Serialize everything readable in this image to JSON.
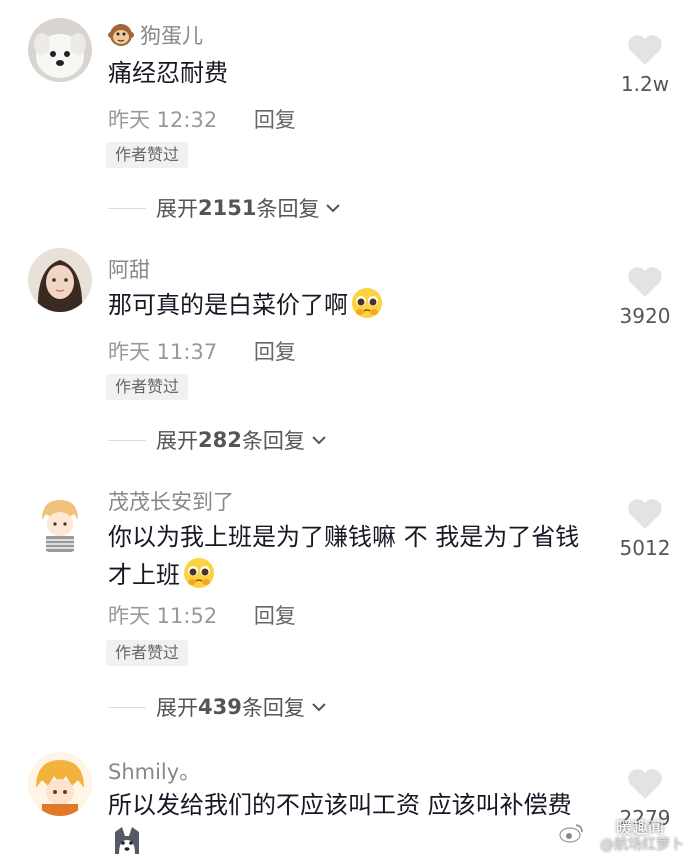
{
  "comments": [
    {
      "username": "狗蛋儿",
      "text": "痛经忍耐费",
      "time": "昨天 12:32",
      "reply_label": "回复",
      "author_liked": "作者赞过",
      "expand_prefix": "展开",
      "expand_count": "2151",
      "expand_suffix": "条回复",
      "likes": "1.2w",
      "badge_icon": "monkey-emoji"
    },
    {
      "username": "阿甜",
      "text": "那可真的是白菜价了啊",
      "time": "昨天 11:37",
      "reply_label": "回复",
      "author_liked": "作者赞过",
      "expand_prefix": "展开",
      "expand_count": "282",
      "expand_suffix": "条回复",
      "likes": "3920",
      "emoji_icon": "pleading-face-emoji"
    },
    {
      "username": "茂茂长安到了",
      "text": "你以为我上班是为了赚钱嘛 不 我是为了省钱才上班",
      "time": "昨天 11:52",
      "reply_label": "回复",
      "author_liked": "作者赞过",
      "expand_prefix": "展开",
      "expand_count": "439",
      "expand_suffix": "条回复",
      "likes": "5012",
      "emoji_icon": "pleading-face-emoji"
    },
    {
      "username": "Shmily。",
      "text": "所以发给我们的不应该叫工资 应该叫补偿费",
      "likes": "2279",
      "emoji_icon": "husky-dog-emoji"
    }
  ],
  "watermark": {
    "line1": "暖趣闻",
    "line2": "@航场红萝卜"
  },
  "colors": {
    "like_heart": "#e3e3e3",
    "tag_bg": "#f1f1f2",
    "text": "#161823",
    "secondary": "#999999"
  }
}
